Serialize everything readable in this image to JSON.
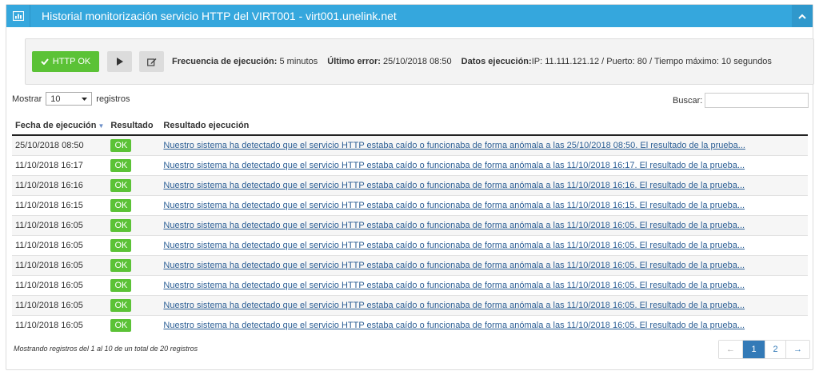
{
  "header": {
    "title": "Historial monitorización servicio HTTP del VIRT001 - virt001.unelink.net",
    "icon": "bar-chart-icon",
    "collapse_icon": "chevron-up-icon",
    "color": "#35a7dd"
  },
  "toolbar": {
    "status_label": "HTTP OK",
    "status_icon": "check-icon",
    "status_color": "#5bc236",
    "play_icon": "play-icon",
    "edit_icon": "edit-icon",
    "frecuencia_label": "Frecuencia de ejecución:",
    "frecuencia_value": "5 minutos",
    "ultimo_error_label": "Último error:",
    "ultimo_error_value": "25/10/2018 08:50",
    "datos_label": "Datos ejecución:",
    "datos_value": "IP: 11.111.121.12 / Puerto: 80 / Tiempo máximo: 10 segundos"
  },
  "length": {
    "prefix": "Mostrar",
    "value": "10",
    "suffix": "registros"
  },
  "search": {
    "label": "Buscar:",
    "value": "",
    "placeholder": ""
  },
  "table": {
    "columns": [
      "Fecha de ejecución",
      "Resultado",
      "Resultado ejecución"
    ],
    "rows": [
      {
        "fecha": "25/10/2018 08:50",
        "resultado": "OK",
        "detalle": "Nuestro sistema ha detectado que el servicio HTTP estaba caído o funcionaba de forma anómala a las 25/10/2018 08:50. El resultado de la prueba..."
      },
      {
        "fecha": "11/10/2018 16:17",
        "resultado": "OK",
        "detalle": "Nuestro sistema ha detectado que el servicio HTTP estaba caído o funcionaba de forma anómala a las 11/10/2018 16:17. El resultado de la prueba..."
      },
      {
        "fecha": "11/10/2018 16:16",
        "resultado": "OK",
        "detalle": "Nuestro sistema ha detectado que el servicio HTTP estaba caído o funcionaba de forma anómala a las 11/10/2018 16:16. El resultado de la prueba..."
      },
      {
        "fecha": "11/10/2018 16:15",
        "resultado": "OK",
        "detalle": "Nuestro sistema ha detectado que el servicio HTTP estaba caído o funcionaba de forma anómala a las 11/10/2018 16:15. El resultado de la prueba..."
      },
      {
        "fecha": "11/10/2018 16:05",
        "resultado": "OK",
        "detalle": "Nuestro sistema ha detectado que el servicio HTTP estaba caído o funcionaba de forma anómala a las 11/10/2018 16:05. El resultado de la prueba..."
      },
      {
        "fecha": "11/10/2018 16:05",
        "resultado": "OK",
        "detalle": "Nuestro sistema ha detectado que el servicio HTTP estaba caído o funcionaba de forma anómala a las 11/10/2018 16:05. El resultado de la prueba..."
      },
      {
        "fecha": "11/10/2018 16:05",
        "resultado": "OK",
        "detalle": "Nuestro sistema ha detectado que el servicio HTTP estaba caído o funcionaba de forma anómala a las 11/10/2018 16:05. El resultado de la prueba..."
      },
      {
        "fecha": "11/10/2018 16:05",
        "resultado": "OK",
        "detalle": "Nuestro sistema ha detectado que el servicio HTTP estaba caído o funcionaba de forma anómala a las 11/10/2018 16:05. El resultado de la prueba..."
      },
      {
        "fecha": "11/10/2018 16:05",
        "resultado": "OK",
        "detalle": "Nuestro sistema ha detectado que el servicio HTTP estaba caído o funcionaba de forma anómala a las 11/10/2018 16:05. El resultado de la prueba..."
      },
      {
        "fecha": "11/10/2018 16:05",
        "resultado": "OK",
        "detalle": "Nuestro sistema ha detectado que el servicio HTTP estaba caído o funcionaba de forma anómala a las 11/10/2018 16:05. El resultado de la prueba..."
      }
    ]
  },
  "footer": {
    "info": "Mostrando registros del 1 al 10 de un total de 20 registros",
    "pagination": {
      "prev": "←",
      "pages": [
        "1",
        "2"
      ],
      "active_page": "1",
      "next": "→"
    }
  }
}
